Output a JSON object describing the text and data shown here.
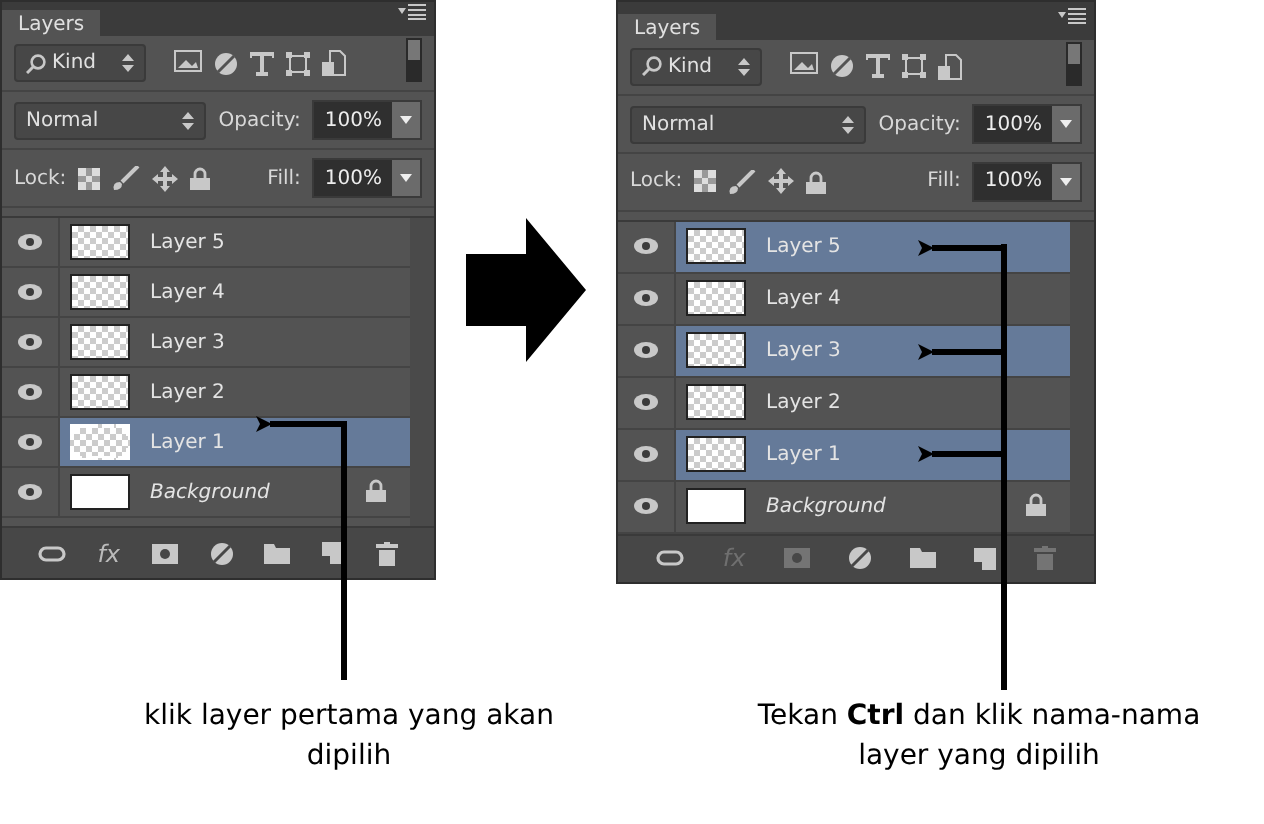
{
  "panels": [
    {
      "tab": "Layers",
      "filter": "Kind",
      "blend_mode": "Normal",
      "opacity_label": "Opacity:",
      "opacity": "100%",
      "lock_label": "Lock:",
      "fill_label": "Fill:",
      "fill": "100%",
      "layers": [
        {
          "name": "Layer 5",
          "kind": "layer",
          "selected": false,
          "thumb_selected": false
        },
        {
          "name": "Layer 4",
          "kind": "layer",
          "selected": false,
          "thumb_selected": false
        },
        {
          "name": "Layer 3",
          "kind": "layer",
          "selected": false,
          "thumb_selected": false
        },
        {
          "name": "Layer 2",
          "kind": "layer",
          "selected": false,
          "thumb_selected": false
        },
        {
          "name": "Layer 1",
          "kind": "layer",
          "selected": true,
          "thumb_selected": true
        },
        {
          "name": "Background",
          "kind": "background",
          "selected": false,
          "thumb_selected": false
        }
      ],
      "bottom_bar": [
        {
          "kind": "link",
          "disabled": false
        },
        {
          "kind": "fx",
          "label": "fx",
          "disabled": false
        },
        {
          "kind": "mask",
          "disabled": false
        },
        {
          "kind": "adjust",
          "disabled": false
        },
        {
          "kind": "folder",
          "disabled": false
        },
        {
          "kind": "new",
          "disabled": false
        },
        {
          "kind": "trash",
          "disabled": false
        }
      ]
    },
    {
      "tab": "Layers",
      "filter": "Kind",
      "blend_mode": "Normal",
      "opacity_label": "Opacity:",
      "opacity": "100%",
      "lock_label": "Lock:",
      "fill_label": "Fill:",
      "fill": "100%",
      "layers": [
        {
          "name": "Layer 5",
          "kind": "layer",
          "selected": true,
          "thumb_selected": false
        },
        {
          "name": "Layer 4",
          "kind": "layer",
          "selected": false,
          "thumb_selected": false
        },
        {
          "name": "Layer 3",
          "kind": "layer",
          "selected": true,
          "thumb_selected": false
        },
        {
          "name": "Layer 2",
          "kind": "layer",
          "selected": false,
          "thumb_selected": false
        },
        {
          "name": "Layer 1",
          "kind": "layer",
          "selected": true,
          "thumb_selected": false
        },
        {
          "name": "Background",
          "kind": "background",
          "selected": false,
          "thumb_selected": false
        }
      ],
      "bottom_bar": [
        {
          "kind": "link",
          "disabled": false
        },
        {
          "kind": "fx",
          "label": "fx",
          "disabled": true
        },
        {
          "kind": "mask",
          "disabled": true
        },
        {
          "kind": "adjust",
          "disabled": false
        },
        {
          "kind": "folder",
          "disabled": false
        },
        {
          "kind": "new",
          "disabled": false
        },
        {
          "kind": "trash",
          "disabled": true
        }
      ]
    }
  ],
  "captions": [
    "klik layer pertama yang akan dipilih",
    "Tekan **Ctrl** dan klik nama-nama layer yang dipilih"
  ]
}
